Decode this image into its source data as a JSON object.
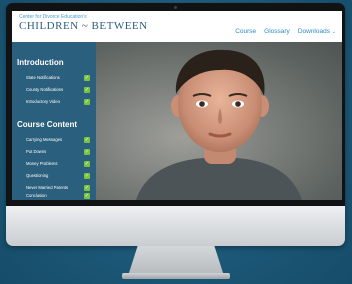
{
  "brand": {
    "kicker": "Center for Divorce Education's",
    "title": "CHILDREN ~ BETWEEN"
  },
  "nav": {
    "course": "Course",
    "glossary": "Glossary",
    "downloads": "Downloads"
  },
  "sidebar": {
    "sections": [
      {
        "title": "Introduction",
        "items": [
          {
            "label": "State Notifications",
            "completed": true
          },
          {
            "label": "County Notifications",
            "completed": true
          },
          {
            "label": "Introductory Video",
            "completed": true
          }
        ]
      },
      {
        "title": "Course Content",
        "items": [
          {
            "label": "Carrying Messages",
            "completed": true
          },
          {
            "label": "Put Downs",
            "completed": true
          },
          {
            "label": "Money Problems",
            "completed": true
          },
          {
            "label": "Questioning",
            "completed": true
          },
          {
            "label": "Never Married Parents",
            "completed": true
          },
          {
            "label": "Conclusion",
            "completed": true
          }
        ]
      }
    ]
  },
  "colors": {
    "sidebar_bg": "#2a5f7d",
    "check_green": "#7cc242",
    "nav_blue": "#2f8dc4",
    "backdrop": "#1f5d7c"
  },
  "icons": {
    "check": "check-icon",
    "apple": "apple-logo-icon",
    "dropdown": "chevron-down-icon"
  }
}
